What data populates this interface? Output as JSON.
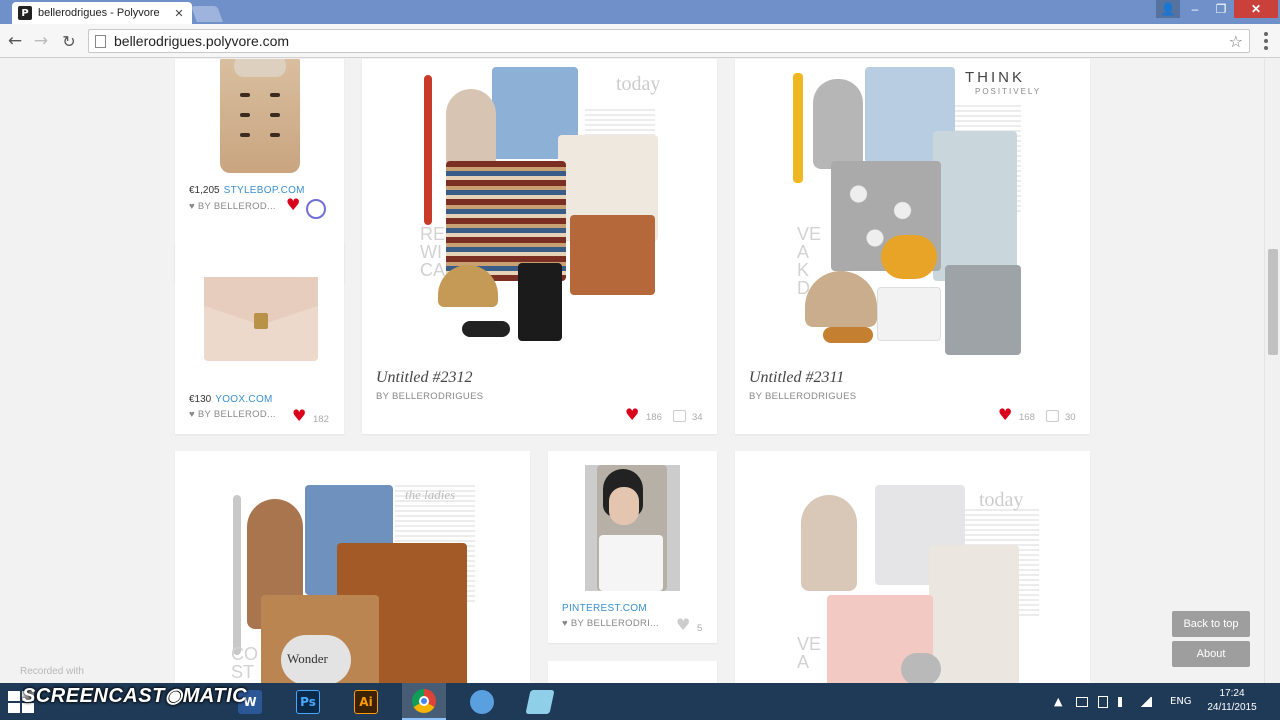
{
  "browser": {
    "tab_title": "bellerodrigues - Polyvore",
    "tab_favicon": "P",
    "url": "bellerodrigues.polyvore.com",
    "close_glyph": "✕",
    "star_glyph": "☆",
    "back_glyph": "←",
    "forward_glyph": "→",
    "reload_glyph": "↻",
    "win_min": "‒",
    "win_max": "❐",
    "win_close": "✕",
    "user_glyph": "👤"
  },
  "items": [
    {
      "price": "€1,205",
      "source": "STYLEBOP.COM",
      "by": "♥ BY BELLEROD...",
      "likes": ""
    },
    {
      "price": "€130",
      "source": "YOOX.COM",
      "by": "♥ BY BELLEROD...",
      "likes": "182"
    }
  ],
  "sets": [
    {
      "title": "Untitled #2312",
      "by": "BY BELLERODRIGUES",
      "likes": "186",
      "comments": "34",
      "overlay_top": "today",
      "overlay_side": "RE WI CA"
    },
    {
      "title": "Untitled #2311",
      "by": "BY BELLERODRIGUES",
      "likes": "168",
      "comments": "30",
      "overlay_top": "THINK",
      "overlay_sub": "POSITIVELY",
      "overlay_side": "VE A K D"
    }
  ],
  "pin_card": {
    "source": "PINTEREST.COM",
    "by": "♥ BY BELLERODRI...",
    "likes": "5"
  },
  "bottom_sets": [
    {
      "overlay_top": "the ladies",
      "overlay_side": "CO ST",
      "caption": "Wonder"
    },
    {
      "overlay_top": "today",
      "overlay_side": "VE A"
    }
  ],
  "side_buttons": {
    "back_to_top": "Back to top",
    "about": "About"
  },
  "heart_glyph": "♥",
  "taskbar": {
    "apps": [
      {
        "name": "word",
        "glyph": "W",
        "color": "#2b5797"
      },
      {
        "name": "photoshop",
        "glyph": "Ps",
        "color": "#0b2a4a"
      },
      {
        "name": "illustrator",
        "glyph": "Ai",
        "color": "#3a2200"
      },
      {
        "name": "chrome",
        "glyph": "",
        "color": "#ffffff"
      }
    ],
    "lang": "ENG",
    "time": "17:24",
    "date": "24/11/2015",
    "tray_up": "▲"
  },
  "watermark": {
    "brand": "SCREENCAST◉MATIC",
    "sub": "Recorded with"
  },
  "colors": {
    "heart": "#d9001b",
    "link": "#3b8fd0",
    "titlebar": "#6f90c9",
    "taskbar": "#1f3a57"
  }
}
